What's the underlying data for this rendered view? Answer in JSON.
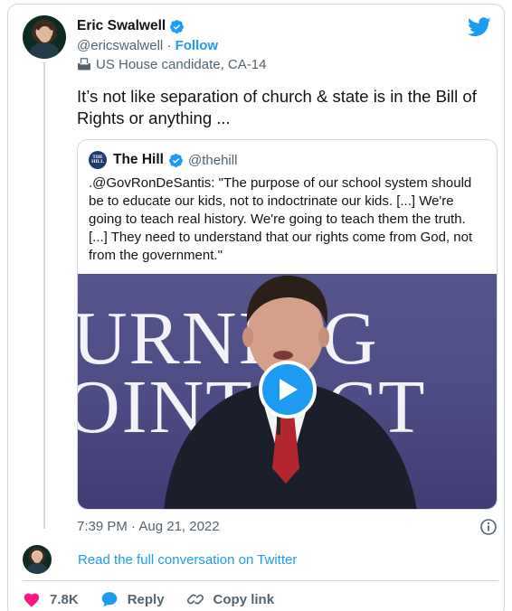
{
  "author": {
    "name": "Eric Swalwell",
    "handle": "@ericswalwell",
    "separator": "·",
    "follow_label": "Follow",
    "label_text": "US House candidate, CA-14"
  },
  "tweet": {
    "text": "It’s not like separation of church & state is in the Bill of Rights or anything ..."
  },
  "quoted": {
    "logo_text": "THE HILL",
    "name": "The Hill",
    "handle": "@thehill",
    "text": ".@GovRonDeSantis: \"The purpose of our school system should be to educate our kids, not to indoctrinate our kids. [...] We're going to teach real history. We're going to teach them the truth. [...] They need to understand that our rights come from God, not from the government.\"",
    "video_bg_top": "URNING",
    "video_bg_bottom": "OINT ACT"
  },
  "meta": {
    "timestamp": "7:39 PM · Aug 21, 2022"
  },
  "conversation": {
    "link_text": "Read the full conversation on Twitter"
  },
  "actions": {
    "likes": "7.8K",
    "reply_label": "Reply",
    "copy_label": "Copy link"
  },
  "colors": {
    "accent": "#1d9bf0",
    "like": "#f91880",
    "secondary_text": "#536471",
    "border": "#cfd9de"
  }
}
